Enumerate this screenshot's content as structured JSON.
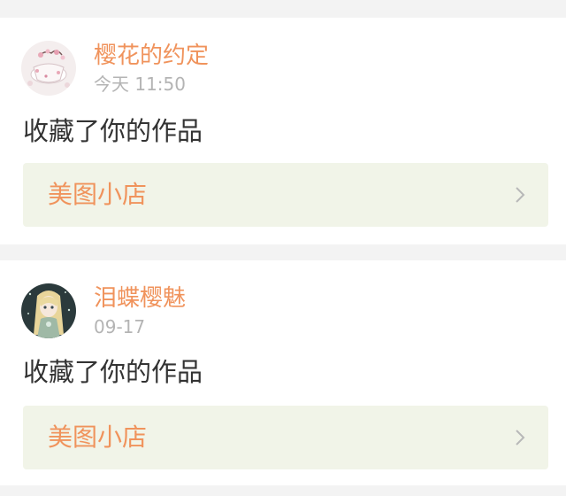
{
  "notifications": [
    {
      "username": "樱花的约定",
      "timestamp": "今天 11:50",
      "action": "收藏了你的作品",
      "shop_label": "美图小店",
      "avatar_icon": "cherry-blossom-teacup-avatar"
    },
    {
      "username": "泪蝶樱魅",
      "timestamp": "09-17",
      "action": "收藏了你的作品",
      "shop_label": "美图小店",
      "avatar_icon": "anime-girl-avatar"
    }
  ],
  "colors": {
    "accent": "#f0935c",
    "link_background": "#f1f4e8",
    "timestamp": "#b4b4b4",
    "body_text": "#333333",
    "page_background": "#f3f3f3"
  },
  "icons": {
    "chevron": "chevron-right-icon"
  }
}
